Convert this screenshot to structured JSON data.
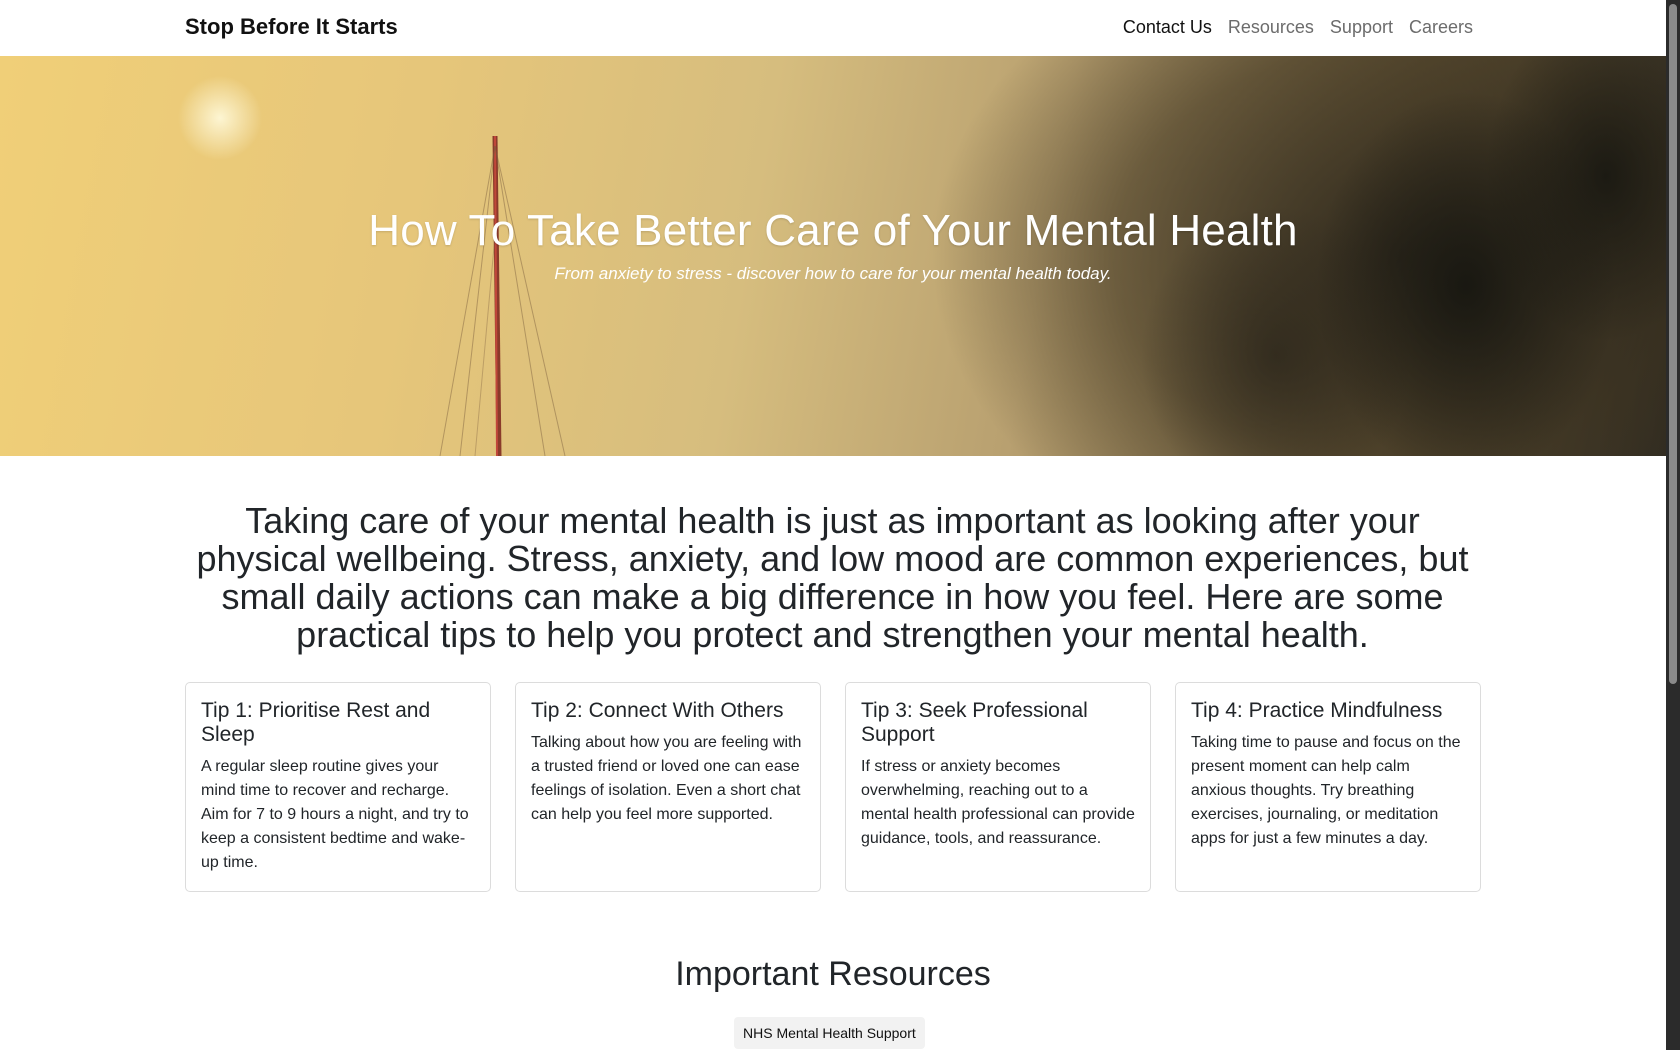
{
  "navbar": {
    "brand": "Stop Before It Starts",
    "links": [
      {
        "label": "Contact Us",
        "active": true
      },
      {
        "label": "Resources",
        "active": false
      },
      {
        "label": "Support",
        "active": false
      },
      {
        "label": "Careers",
        "active": false
      }
    ]
  },
  "hero": {
    "title": "How To Take Better Care of Your Mental Health",
    "subtitle": "From anxiety to stress - discover how to care for your mental health today."
  },
  "intro": {
    "text": "Taking care of your mental health is just as important as looking after your physical wellbeing. Stress, anxiety, and low mood are common experiences, but small daily actions can make a big difference in how you feel. Here are some practical tips to help you protect and strengthen your mental health."
  },
  "tips": [
    {
      "title": "Tip 1: Prioritise Rest and Sleep",
      "text": "A regular sleep routine gives your mind time to recover and recharge. Aim for 7 to 9 hours a night, and try to keep a consistent bedtime and wake-up time."
    },
    {
      "title": "Tip 2: Connect With Others",
      "text": "Talking about how you are feeling with a trusted friend or loved one can ease feelings of isolation. Even a short chat can help you feel more supported."
    },
    {
      "title": "Tip 3: Seek Professional Support",
      "text": "If stress or anxiety becomes overwhelming, reaching out to a mental health professional can provide guidance, tools, and reassurance."
    },
    {
      "title": "Tip 4: Practice Mindfulness",
      "text": "Taking time to pause and focus on the present moment can help calm anxious thoughts. Try breathing exercises, journaling, or meditation apps for just a few minutes a day."
    }
  ],
  "resources": {
    "heading": "Important Resources",
    "buttons": [
      {
        "label": "NHS Mental Health Support"
      }
    ]
  }
}
